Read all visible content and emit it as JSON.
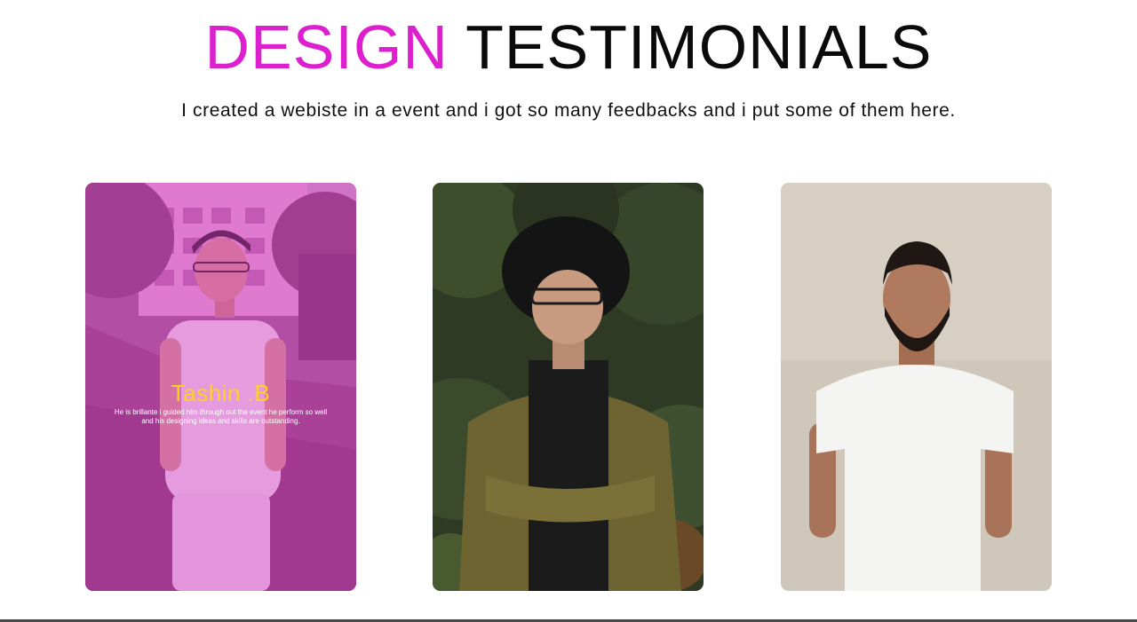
{
  "header": {
    "title_accent": "DESIGN",
    "title_rest": "TESTIMONIALS",
    "subtitle": "I created a webiste in a event and i got so many feedbacks and i put some of them here."
  },
  "testimonials": [
    {
      "name": "Tashin .B",
      "quote": "He is brillante i guided him through out the event he perform so well and his designing ideas and skills are outstanding.",
      "active": true
    },
    {
      "name": "",
      "quote": "",
      "active": false
    },
    {
      "name": "",
      "quote": "",
      "active": false
    }
  ],
  "colors": {
    "accent": "#dd20cf",
    "name_highlight": "#ffd21f",
    "overlay": "#d628c8",
    "text_dark": "#0a0a0a"
  }
}
